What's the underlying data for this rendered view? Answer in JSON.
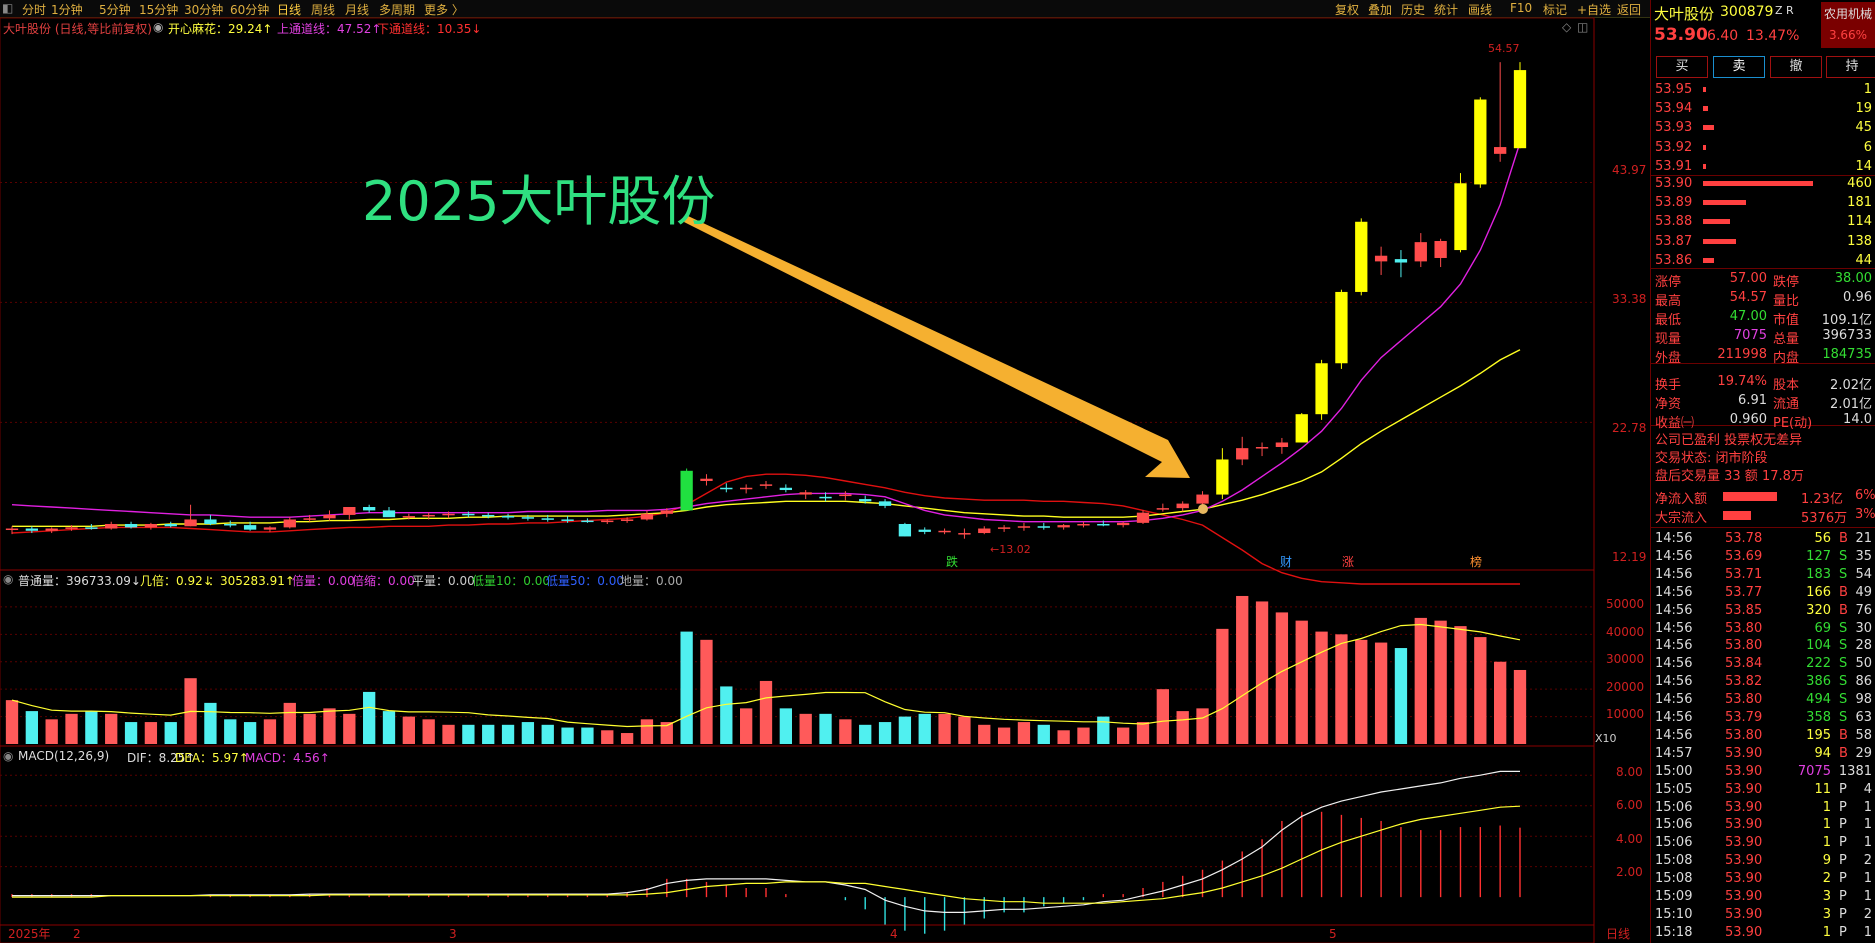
{
  "toolbar": {
    "tabs": [
      "分时",
      "1分钟",
      "5分钟",
      "15分钟",
      "30分钟",
      "60分钟",
      "日线",
      "周线",
      "月线",
      "多周期",
      "更多 〉"
    ],
    "right": [
      "复权",
      "叠加",
      "历史",
      "统计",
      "画线",
      "F10",
      "标记",
      "+自选",
      "返回"
    ]
  },
  "chart_legend": {
    "title": "大叶股份 (日线,等比前复权)",
    "kxmh": "开心麻花：29.24↑",
    "upper": "上通道线：47.52↑",
    "lower": "下通道线：10.35↓"
  },
  "annotation": "2025大叶股份",
  "price_axis": [
    "43.97",
    "33.38",
    "22.78",
    "12.19"
  ],
  "high_label": "54.57",
  "low_label": "←13.02",
  "event_marks": [
    "跌",
    "财",
    "涨",
    "榜"
  ],
  "volume_legend": {
    "a": "普通量：396733.09↓",
    "b": "几倍：0.92↓",
    "c": "：305283.91↑",
    "d": "倍量：0.00",
    "e": "倍缩：0.00",
    "f": "平量：0.00",
    "g": "低量10：0.00",
    "h": "低量50：0.00",
    "i": "地量：0.00"
  },
  "volume_axis": [
    "50000",
    "40000",
    "30000",
    "20000",
    "10000",
    "X10"
  ],
  "macd_legend": {
    "a": "MACD(12,26,9)",
    "b": "DIF：8.25↑",
    "c": "DEA：5.97↑",
    "d": "MACD：4.56↑"
  },
  "macd_axis": [
    "8.00",
    "6.00",
    "4.00",
    "2.00"
  ],
  "date_axis": {
    "year": "2025年",
    "months": [
      "2",
      "3",
      "4",
      "5"
    ],
    "period": "日线"
  },
  "chart_data": {
    "type": "candlestick",
    "candles": [
      [
        13.3,
        13.6,
        12.9,
        13.4
      ],
      [
        13.4,
        13.6,
        13.0,
        13.2
      ],
      [
        13.2,
        13.5,
        13.0,
        13.4
      ],
      [
        13.4,
        13.7,
        13.2,
        13.5
      ],
      [
        13.5,
        13.8,
        13.3,
        13.4
      ],
      [
        13.4,
        14.0,
        13.3,
        13.8
      ],
      [
        13.8,
        14.0,
        13.4,
        13.5
      ],
      [
        13.5,
        13.9,
        13.3,
        13.8
      ],
      [
        13.8,
        14.0,
        13.5,
        13.6
      ],
      [
        13.6,
        15.5,
        13.6,
        14.2
      ],
      [
        14.2,
        14.6,
        13.7,
        13.8
      ],
      [
        13.8,
        14.1,
        13.5,
        13.7
      ],
      [
        13.7,
        14.0,
        13.2,
        13.3
      ],
      [
        13.3,
        13.6,
        13.1,
        13.5
      ],
      [
        13.5,
        14.4,
        13.4,
        14.2
      ],
      [
        14.2,
        14.6,
        14.0,
        14.3
      ],
      [
        14.3,
        15.0,
        14.1,
        14.6
      ],
      [
        14.6,
        15.2,
        14.2,
        15.3
      ],
      [
        15.3,
        15.5,
        14.8,
        15.0
      ],
      [
        15.0,
        15.3,
        14.6,
        14.4
      ],
      [
        14.4,
        14.7,
        14.2,
        14.5
      ],
      [
        14.5,
        14.8,
        14.2,
        14.6
      ],
      [
        14.6,
        14.9,
        14.3,
        14.7
      ],
      [
        14.7,
        14.9,
        14.4,
        14.6
      ],
      [
        14.6,
        14.8,
        14.3,
        14.5
      ],
      [
        14.5,
        14.7,
        14.2,
        14.4
      ],
      [
        14.4,
        14.6,
        14.1,
        14.3
      ],
      [
        14.3,
        14.6,
        14.0,
        14.2
      ],
      [
        14.2,
        14.5,
        13.9,
        14.1
      ],
      [
        14.1,
        14.3,
        13.9,
        14.0
      ],
      [
        14.0,
        14.2,
        13.8,
        14.1
      ],
      [
        14.1,
        14.4,
        13.9,
        14.2
      ],
      [
        14.2,
        15.0,
        14.1,
        14.7
      ],
      [
        14.7,
        15.2,
        14.4,
        15.0
      ],
      [
        18.5,
        18.7,
        15.0,
        15.0
      ],
      [
        17.6,
        18.2,
        17.2,
        17.8
      ],
      [
        17.0,
        17.4,
        16.6,
        16.9
      ],
      [
        16.9,
        17.3,
        16.5,
        17.0
      ],
      [
        17.2,
        17.6,
        16.9,
        17.3
      ],
      [
        17.0,
        17.3,
        16.6,
        16.8
      ],
      [
        16.4,
        16.8,
        16.0,
        16.6
      ],
      [
        16.2,
        16.6,
        15.8,
        16.1
      ],
      [
        16.3,
        16.7,
        15.9,
        16.4
      ],
      [
        16.0,
        16.3,
        15.6,
        15.8
      ],
      [
        15.8,
        16.0,
        15.2,
        15.4
      ],
      [
        13.8,
        13.9,
        12.7,
        12.7
      ],
      [
        13.3,
        13.5,
        12.9,
        13.1
      ],
      [
        13.1,
        13.4,
        12.9,
        13.2
      ],
      [
        12.9,
        13.4,
        12.5,
        13.0
      ],
      [
        13.0,
        13.6,
        12.9,
        13.4
      ],
      [
        13.4,
        13.7,
        13.1,
        13.5
      ],
      [
        13.5,
        13.9,
        13.2,
        13.6
      ],
      [
        13.6,
        13.9,
        13.3,
        13.5
      ],
      [
        13.5,
        13.8,
        13.3,
        13.7
      ],
      [
        13.7,
        14.0,
        13.5,
        13.8
      ],
      [
        13.8,
        14.1,
        13.6,
        13.7
      ],
      [
        13.7,
        14.0,
        13.5,
        13.9
      ],
      [
        13.9,
        15.0,
        13.8,
        14.8
      ],
      [
        15.1,
        15.6,
        14.9,
        15.2
      ],
      [
        15.2,
        15.8,
        14.9,
        15.6
      ],
      [
        15.6,
        16.7,
        15.4,
        16.4
      ],
      [
        16.4,
        20.5,
        16.0,
        19.5
      ],
      [
        19.5,
        21.5,
        19.0,
        20.5
      ],
      [
        20.5,
        21.0,
        19.8,
        20.6
      ],
      [
        20.6,
        21.4,
        20.0,
        21.0
      ],
      [
        21.0,
        23.6,
        21.0,
        23.5
      ],
      [
        23.5,
        28.3,
        23.0,
        28.0
      ],
      [
        28.0,
        34.5,
        27.5,
        34.3
      ],
      [
        34.3,
        40.8,
        34.0,
        40.5
      ],
      [
        37.0,
        38.3,
        35.8,
        37.5
      ],
      [
        37.2,
        38.0,
        35.6,
        36.9
      ],
      [
        37.0,
        39.5,
        36.5,
        38.7
      ],
      [
        37.3,
        39.0,
        36.5,
        38.8
      ],
      [
        38.0,
        44.8,
        37.8,
        43.9
      ],
      [
        43.8,
        51.5,
        43.5,
        51.3
      ],
      [
        46.5,
        54.6,
        45.8,
        47.1
      ],
      [
        47.0,
        54.6,
        47.0,
        53.9
      ]
    ],
    "up_channel": [
      15.5,
      15.4,
      15.3,
      15.2,
      15.1,
      15.0,
      14.9,
      14.8,
      14.7,
      14.6,
      14.6,
      14.5,
      14.4,
      14.4,
      14.4,
      14.5,
      14.6,
      14.7,
      14.8,
      14.8,
      14.8,
      14.8,
      14.8,
      14.8,
      14.8,
      14.8,
      14.9,
      14.9,
      14.9,
      14.9,
      15.0,
      15.0,
      15.0,
      15.1,
      15.3,
      15.6,
      15.8,
      16.0,
      16.2,
      16.4,
      16.5,
      16.5,
      16.5,
      16.4,
      16.2,
      15.6,
      15.0,
      14.6,
      14.4,
      14.2,
      14.1,
      14.0,
      14.0,
      14.0,
      14.0,
      14.0,
      14.0,
      14.1,
      14.3,
      14.6,
      15.0,
      15.8,
      16.8,
      18.0,
      19.2,
      20.5,
      22.0,
      24.0,
      26.5,
      28.5,
      30.0,
      31.5,
      33.0,
      35.0,
      38.0,
      42.0,
      47.5
    ],
    "lower_channel": [
      13.0,
      13.1,
      13.2,
      13.3,
      13.4,
      13.5,
      13.5,
      13.5,
      13.5,
      13.4,
      13.3,
      13.2,
      13.1,
      13.1,
      13.2,
      13.3,
      13.4,
      13.5,
      13.5,
      13.6,
      13.6,
      13.6,
      13.7,
      13.7,
      13.8,
      13.8,
      13.9,
      13.9,
      14.0,
      14.1,
      14.2,
      14.3,
      14.5,
      14.8,
      15.5,
      16.5,
      17.5,
      18.0,
      18.2,
      18.2,
      18.1,
      17.9,
      17.6,
      17.3,
      17.0,
      16.6,
      16.3,
      16.1,
      16.0,
      15.9,
      15.9,
      15.9,
      15.8,
      15.8,
      15.7,
      15.6,
      15.4,
      15.0,
      14.6,
      14.2,
      13.7,
      12.6,
      11.5,
      10.3,
      9.5,
      9.0,
      8.7,
      8.6,
      8.5,
      8.5,
      8.5,
      8.5,
      8.5,
      8.5,
      8.5,
      8.5,
      8.5
    ],
    "ma_line": [
      13.6,
      13.6,
      13.6,
      13.6,
      13.6,
      13.7,
      13.7,
      13.7,
      13.8,
      13.8,
      13.8,
      13.9,
      13.9,
      13.9,
      14.0,
      14.0,
      14.1,
      14.1,
      14.2,
      14.2,
      14.3,
      14.3,
      14.3,
      14.4,
      14.4,
      14.5,
      14.5,
      14.5,
      14.5,
      14.5,
      14.5,
      14.6,
      14.7,
      14.8,
      15.0,
      15.3,
      15.5,
      15.6,
      15.7,
      15.8,
      15.8,
      15.8,
      15.8,
      15.7,
      15.6,
      15.4,
      15.2,
      15.0,
      14.8,
      14.7,
      14.6,
      14.5,
      14.5,
      14.4,
      14.4,
      14.4,
      14.4,
      14.5,
      14.7,
      14.9,
      15.1,
      15.5,
      15.9,
      16.4,
      17.0,
      17.6,
      18.4,
      19.6,
      20.9,
      22.0,
      23.0,
      24.0,
      25.0,
      26.0,
      27.1,
      28.3,
      29.2
    ],
    "volume": [
      16000,
      12000,
      9000,
      11000,
      12000,
      11000,
      8000,
      8000,
      8000,
      24000,
      15000,
      9000,
      8000,
      9000,
      15000,
      11000,
      13000,
      11000,
      19000,
      12000,
      10000,
      9000,
      7000,
      7000,
      7000,
      7000,
      8000,
      7000,
      6000,
      6000,
      5000,
      4000,
      9000,
      8000,
      41000,
      38000,
      21000,
      13000,
      23000,
      13000,
      11000,
      11000,
      9000,
      7000,
      8000,
      10000,
      11000,
      11000,
      10000,
      7000,
      6000,
      8000,
      7000,
      5000,
      6000,
      10000,
      6000,
      8000,
      20000,
      12000,
      13000,
      42000,
      54000,
      52000,
      48000,
      45000,
      41000,
      40000,
      38000,
      37000,
      35000,
      46000,
      45000,
      43000,
      39000,
      30000,
      27000
    ],
    "dif": [
      0.1,
      0.1,
      0.1,
      0.1,
      0.1,
      0.1,
      0.1,
      0.1,
      0.1,
      0.1,
      0.15,
      0.15,
      0.15,
      0.15,
      0.15,
      0.2,
      0.2,
      0.2,
      0.2,
      0.2,
      0.2,
      0.2,
      0.2,
      0.2,
      0.2,
      0.2,
      0.2,
      0.2,
      0.2,
      0.2,
      0.2,
      0.3,
      0.5,
      0.9,
      1.1,
      1.2,
      1.2,
      1.2,
      1.2,
      1.1,
      1.0,
      1.0,
      0.8,
      0.5,
      -0.2,
      -0.6,
      -0.9,
      -1.0,
      -1.0,
      -0.9,
      -0.8,
      -0.8,
      -0.7,
      -0.6,
      -0.5,
      -0.3,
      -0.2,
      0.1,
      0.4,
      0.8,
      1.2,
      1.8,
      2.5,
      3.3,
      4.4,
      5.3,
      5.9,
      6.3,
      6.6,
      6.9,
      7.1,
      7.3,
      7.5,
      7.8,
      8.0,
      8.25,
      8.25
    ],
    "dea": [
      0.0,
      0.0,
      0.0,
      0.0,
      0.0,
      0.1,
      0.1,
      0.1,
      0.1,
      0.1,
      0.1,
      0.1,
      0.1,
      0.1,
      0.1,
      0.1,
      0.15,
      0.15,
      0.15,
      0.15,
      0.15,
      0.15,
      0.15,
      0.15,
      0.15,
      0.15,
      0.15,
      0.15,
      0.15,
      0.15,
      0.15,
      0.15,
      0.2,
      0.3,
      0.5,
      0.7,
      0.8,
      0.9,
      0.9,
      1.0,
      1.0,
      1.0,
      0.9,
      0.9,
      0.7,
      0.5,
      0.3,
      0.1,
      -0.1,
      -0.2,
      -0.3,
      -0.3,
      -0.4,
      -0.4,
      -0.4,
      -0.4,
      -0.3,
      -0.2,
      -0.1,
      0.1,
      0.3,
      0.6,
      1.0,
      1.4,
      1.9,
      2.5,
      3.1,
      3.6,
      4.0,
      4.4,
      4.8,
      5.1,
      5.3,
      5.5,
      5.7,
      5.9,
      5.97
    ],
    "ylim": [
      10.0,
      57.0
    ],
    "vol_ylim": [
      0,
      58000
    ],
    "macd_ylim": [
      -1.5,
      9.0
    ]
  },
  "quote": {
    "name": "大叶股份",
    "code": "300879",
    "suffix": "Z R",
    "sector": "农用机械",
    "sector_pct": "3.66%",
    "price": "53.90",
    "change": "6.40",
    "pct": "13.47%",
    "buttons": [
      "买",
      "卖",
      "撤",
      "持"
    ]
  },
  "asks": [
    [
      "53.95",
      "1"
    ],
    [
      "53.94",
      "19"
    ],
    [
      "53.93",
      "45"
    ],
    [
      "53.92",
      "6"
    ],
    [
      "53.91",
      "14"
    ]
  ],
  "bids": [
    [
      "53.90",
      "460"
    ],
    [
      "53.89",
      "181"
    ],
    [
      "53.88",
      "114"
    ],
    [
      "53.87",
      "138"
    ],
    [
      "53.86",
      "44"
    ]
  ],
  "stats": [
    [
      "涨停",
      "57.00",
      "跌停",
      "38.00"
    ],
    [
      "最高",
      "54.57",
      "量比",
      "0.96"
    ],
    [
      "最低",
      "47.00",
      "市值",
      "109.1亿"
    ],
    [
      "现量",
      "7075",
      "总量",
      "396733"
    ],
    [
      "外盘",
      "211998",
      "内盘",
      "184735"
    ],
    [
      "换手",
      "19.74%",
      "股本",
      "2.02亿"
    ],
    [
      "净资",
      "6.91",
      "流通",
      "2.01亿"
    ],
    [
      "收益㈠",
      "0.960",
      "PE(动)",
      "14.0"
    ]
  ],
  "info": {
    "line1": "公司已盈利 投票权无差异",
    "line2": "交易状态: 闭市阶段",
    "line3": "盘后交易量 33 额 17.8万",
    "flow1_label": "净流入额",
    "flow1_val": "1.23亿",
    "flow1_pct": "6%",
    "flow2_label": "大宗流入",
    "flow2_val": "5376万",
    "flow2_pct": "3%"
  },
  "ticks": [
    [
      "14:56",
      "53.78",
      "56",
      "B",
      "21"
    ],
    [
      "14:56",
      "53.69",
      "127",
      "S",
      "35"
    ],
    [
      "14:56",
      "53.71",
      "183",
      "S",
      "54"
    ],
    [
      "14:56",
      "53.77",
      "166",
      "B",
      "49"
    ],
    [
      "14:56",
      "53.85",
      "320",
      "B",
      "76"
    ],
    [
      "14:56",
      "53.80",
      "69",
      "S",
      "30"
    ],
    [
      "14:56",
      "53.80",
      "104",
      "S",
      "28"
    ],
    [
      "14:56",
      "53.84",
      "222",
      "S",
      "50"
    ],
    [
      "14:56",
      "53.82",
      "386",
      "S",
      "86"
    ],
    [
      "14:56",
      "53.80",
      "494",
      "S",
      "98"
    ],
    [
      "14:56",
      "53.79",
      "358",
      "S",
      "63"
    ],
    [
      "14:56",
      "53.80",
      "195",
      "B",
      "58"
    ],
    [
      "14:57",
      "53.90",
      "94",
      "B",
      "29"
    ],
    [
      "15:00",
      "53.90",
      "7075",
      "",
      "1381"
    ],
    [
      "15:05",
      "53.90",
      "11",
      "P",
      "4"
    ],
    [
      "15:06",
      "53.90",
      "1",
      "P",
      "1"
    ],
    [
      "15:06",
      "53.90",
      "1",
      "P",
      "1"
    ],
    [
      "15:06",
      "53.90",
      "1",
      "P",
      "1"
    ],
    [
      "15:08",
      "53.90",
      "9",
      "P",
      "2"
    ],
    [
      "15:08",
      "53.90",
      "2",
      "P",
      "1"
    ],
    [
      "15:09",
      "53.90",
      "3",
      "P",
      "1"
    ],
    [
      "15:10",
      "53.90",
      "3",
      "P",
      "2"
    ],
    [
      "15:18",
      "53.90",
      "1",
      "P",
      "1"
    ]
  ]
}
